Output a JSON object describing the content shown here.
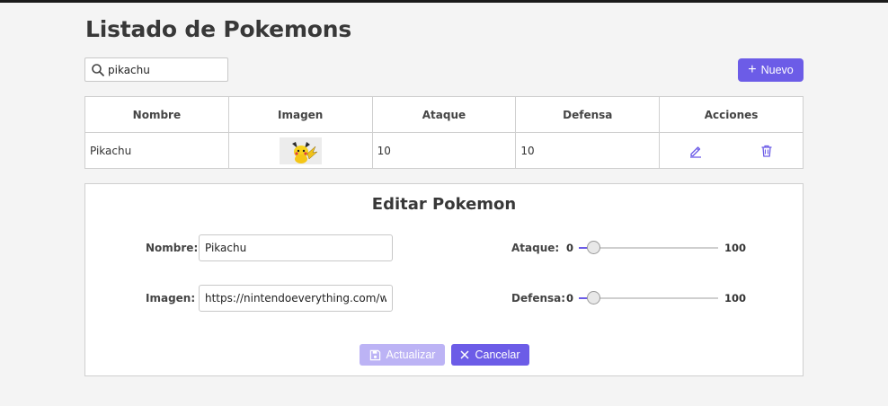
{
  "page": {
    "title": "Listado de Pokemons"
  },
  "search": {
    "value": "pikachu",
    "icon": "search-icon"
  },
  "toolbar": {
    "new_label": "Nuevo",
    "new_icon": "plus-icon"
  },
  "table": {
    "headers": [
      "Nombre",
      "Imagen",
      "Ataque",
      "Defensa",
      "Acciones"
    ],
    "rows": [
      {
        "name": "Pikachu",
        "image_icon": "pikachu-image",
        "attack": "10",
        "defense": "10",
        "actions": [
          "edit-icon",
          "trash-icon"
        ]
      }
    ]
  },
  "edit_form": {
    "title": "Editar Pokemon",
    "name_label": "Nombre:",
    "name_value": "Pikachu",
    "image_label": "Imagen:",
    "image_value": "https://nintendoeverything.com/w",
    "attack": {
      "label": "Ataque:",
      "min": "0",
      "max": "100",
      "value": 10
    },
    "defense": {
      "label": "Defensa:",
      "min": "0",
      "max": "100",
      "value": 10
    },
    "update_label": "Actualizar",
    "update_icon": "save-icon",
    "cancel_label": "Cancelar",
    "cancel_icon": "close-icon"
  },
  "colors": {
    "accent": "#6c5ce7",
    "accent_disabled": "#bcb3f5",
    "background": "#f4f4f4"
  }
}
